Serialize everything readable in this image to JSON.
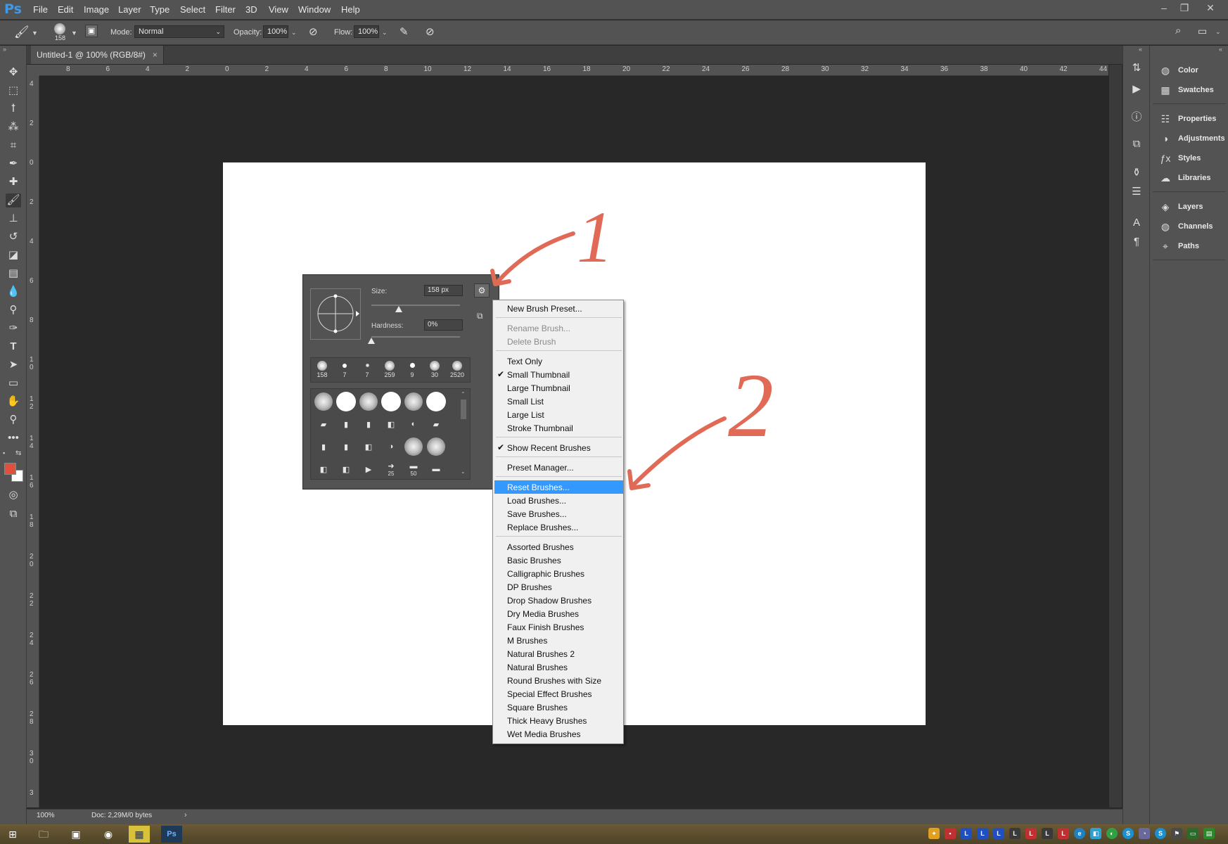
{
  "app": {
    "logo": "Ps"
  },
  "menu": [
    "File",
    "Edit",
    "Image",
    "Layer",
    "Type",
    "Select",
    "Filter",
    "3D",
    "View",
    "Window",
    "Help"
  ],
  "window_controls": {
    "minimize": "–",
    "restore": "❐",
    "close": "✕"
  },
  "options_bar": {
    "brush_size": "158",
    "mode_label": "Mode:",
    "mode_value": "Normal",
    "opacity_label": "Opacity:",
    "opacity_value": "100%",
    "flow_label": "Flow:",
    "flow_value": "100%"
  },
  "document_tab": {
    "title": "Untitled-1 @ 100% (RGB/8#)",
    "close": "×"
  },
  "ruler_top": [
    "8",
    "6",
    "4",
    "2",
    "0",
    "2",
    "4",
    "6",
    "8",
    "10",
    "12",
    "14",
    "16",
    "18",
    "20",
    "22",
    "24",
    "26",
    "28",
    "30",
    "32",
    "34",
    "36",
    "38",
    "40",
    "42",
    "44"
  ],
  "ruler_left": [
    "4",
    "2",
    "0",
    "2",
    "4",
    "6",
    "8",
    "1 0",
    "1 2",
    "1 4",
    "1 6",
    "1 8",
    "2 0",
    "2 2",
    "2 4",
    "2 6",
    "2 8",
    "3 0",
    "3"
  ],
  "status": {
    "zoom": "100%",
    "doc": "Doc: 2,29M/0 bytes",
    "arrow": "›"
  },
  "dock_groups": [
    [
      {
        "label": "Color",
        "icon": "color-icon"
      },
      {
        "label": "Swatches",
        "icon": "swatches-icon"
      }
    ],
    [
      {
        "label": "Properties",
        "icon": "properties-icon"
      },
      {
        "label": "Adjustments",
        "icon": "adjustments-icon"
      },
      {
        "label": "Styles",
        "icon": "styles-icon"
      },
      {
        "label": "Libraries",
        "icon": "libraries-icon"
      }
    ],
    [
      {
        "label": "Layers",
        "icon": "layers-icon"
      },
      {
        "label": "Channels",
        "icon": "channels-icon"
      },
      {
        "label": "Paths",
        "icon": "paths-icon"
      }
    ]
  ],
  "brush_panel": {
    "size_label": "Size:",
    "size_value": "158 px",
    "hardness_label": "Hardness:",
    "hardness_value": "0%",
    "size_fraction": 0.31,
    "hardness_fraction": 0.0,
    "recent_sizes": [
      "158",
      "7",
      "7",
      "259",
      "9",
      "30",
      "2520"
    ],
    "grid_numbers": [
      "25",
      "50"
    ]
  },
  "context_menu": {
    "groups": [
      [
        {
          "label": "New Brush Preset...",
          "state": "enabled"
        }
      ],
      [
        {
          "label": "Rename Brush...",
          "state": "disabled"
        },
        {
          "label": "Delete Brush",
          "state": "disabled"
        }
      ],
      [
        {
          "label": "Text Only",
          "state": "enabled"
        },
        {
          "label": "Small Thumbnail",
          "state": "checked"
        },
        {
          "label": "Large Thumbnail",
          "state": "enabled"
        },
        {
          "label": "Small List",
          "state": "enabled"
        },
        {
          "label": "Large List",
          "state": "enabled"
        },
        {
          "label": "Stroke Thumbnail",
          "state": "enabled"
        }
      ],
      [
        {
          "label": "Show Recent Brushes",
          "state": "checked"
        }
      ],
      [
        {
          "label": "Preset Manager...",
          "state": "enabled"
        }
      ],
      [
        {
          "label": "Reset Brushes...",
          "state": "highlighted"
        },
        {
          "label": "Load Brushes...",
          "state": "enabled"
        },
        {
          "label": "Save Brushes...",
          "state": "enabled"
        },
        {
          "label": "Replace Brushes...",
          "state": "enabled"
        }
      ],
      [
        {
          "label": "Assorted Brushes",
          "state": "enabled"
        },
        {
          "label": "Basic Brushes",
          "state": "enabled"
        },
        {
          "label": "Calligraphic Brushes",
          "state": "enabled"
        },
        {
          "label": "DP Brushes",
          "state": "enabled"
        },
        {
          "label": "Drop Shadow Brushes",
          "state": "enabled"
        },
        {
          "label": "Dry Media Brushes",
          "state": "enabled"
        },
        {
          "label": "Faux Finish Brushes",
          "state": "enabled"
        },
        {
          "label": "M Brushes",
          "state": "enabled"
        },
        {
          "label": "Natural Brushes 2",
          "state": "enabled"
        },
        {
          "label": "Natural Brushes",
          "state": "enabled"
        },
        {
          "label": "Round Brushes with Size",
          "state": "enabled"
        },
        {
          "label": "Special Effect Brushes",
          "state": "enabled"
        },
        {
          "label": "Square Brushes",
          "state": "enabled"
        },
        {
          "label": "Thick Heavy Brushes",
          "state": "enabled"
        },
        {
          "label": "Wet Media Brushes",
          "state": "enabled"
        }
      ]
    ]
  },
  "annotations": [
    "1",
    "2"
  ],
  "colors": {
    "accent": "#3399ff",
    "annotation": "#e06a55",
    "foreground_swatch": "#e0503c",
    "background_swatch": "#ffffff",
    "canvas": "#ffffff"
  }
}
